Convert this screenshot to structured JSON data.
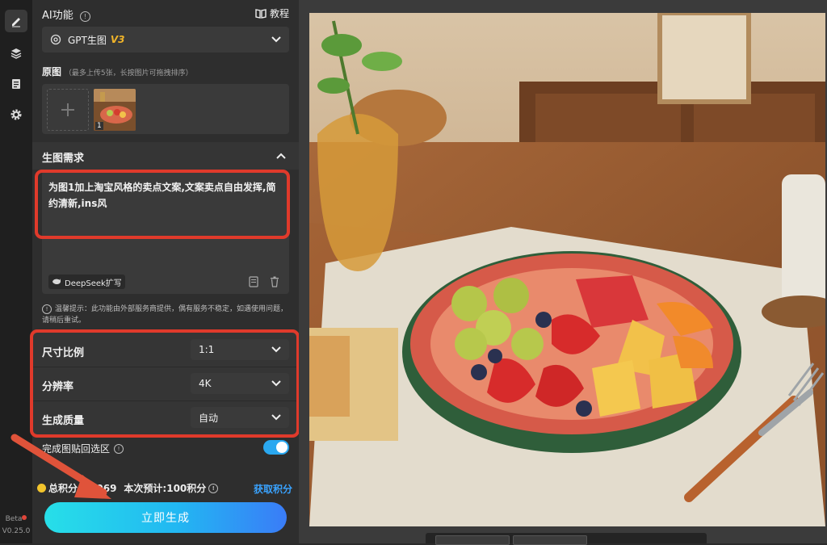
{
  "rail": {
    "items": [
      "edit",
      "layers",
      "notes",
      "settings"
    ],
    "beta_label": "Beta",
    "version": "V0.25.0"
  },
  "panel": {
    "ai_feature_label": "AI功能",
    "tutorial_label": "教程",
    "model_select": {
      "value": "GPT生图",
      "badge": "V3"
    },
    "original": {
      "label": "原图",
      "hint": "（最多上传5张，长按图片可拖拽排序）",
      "thumb_index": "1"
    },
    "requirement": {
      "label": "生图需求",
      "prompt_text": "为图1加上淘宝风格的卖点文案,文案卖点自由发挥,简约清新,ins风",
      "deepseek_label": "DeepSeek扩写"
    },
    "notice": "温馨提示：此功能由外部服务商提供，偶有服务不稳定，如遇使用问题，请稍后重试。",
    "options": [
      {
        "label": "尺寸比例",
        "value": "1:1"
      },
      {
        "label": "分辨率",
        "value": "4K"
      },
      {
        "label": "生成质量",
        "value": "自动"
      }
    ],
    "paste_back": {
      "label": "完成图贴回选区",
      "enabled": true
    },
    "points": {
      "total_label": "总积分：",
      "total_value": "1069",
      "estimate_label": "本次预计:100积分",
      "get_points_label": "获取积分"
    },
    "generate_label": "立即生成"
  },
  "colors": {
    "accent_red": "#e03a2b",
    "accent_blue": "#2aa8f0",
    "link_blue": "#3aa3ff"
  }
}
